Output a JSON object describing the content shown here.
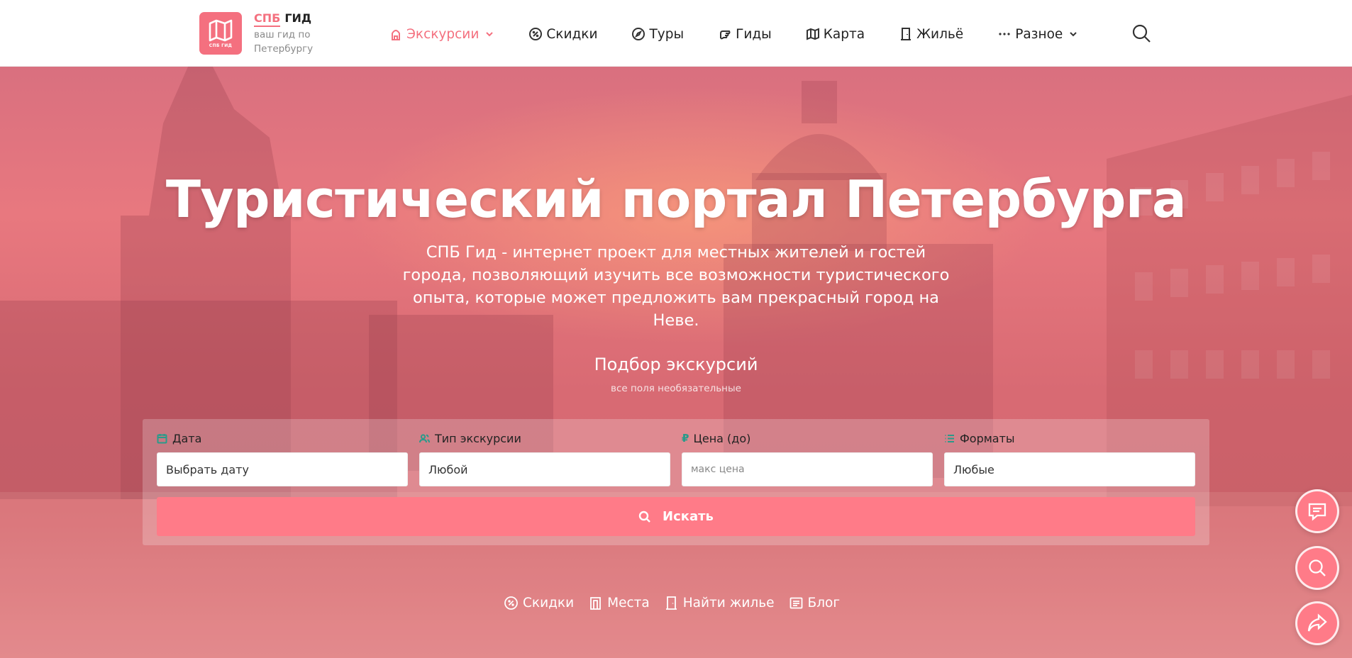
{
  "header": {
    "logo_text": "СПБ ГИД",
    "brand_spb": "СПБ",
    "brand_gid": "ГИД",
    "brand_sub": "ваш гид по Петербургу",
    "nav": [
      {
        "label": "Экскурсии",
        "icon": "excursion-icon",
        "active": true,
        "dropdown": true
      },
      {
        "label": "Скидки",
        "icon": "discount-icon"
      },
      {
        "label": "Туры",
        "icon": "compass-icon"
      },
      {
        "label": "Гиды",
        "icon": "hand-icon"
      },
      {
        "label": "Карта",
        "icon": "map-icon"
      },
      {
        "label": "Жильё",
        "icon": "door-icon"
      },
      {
        "label": "Разное",
        "icon": "dots-icon",
        "dropdown": true
      }
    ]
  },
  "hero": {
    "title": "Туристический портал Петербурга",
    "description": "СПБ Гид - интернет проект для местных жителей и гостей города, позволяющий изучить все возможности туристического опыта, которые может предложить вам прекрасный город на Неве.",
    "subtitle": "Подбор экскурсий",
    "note": "все поля необязательные"
  },
  "form": {
    "date": {
      "label": "Дата",
      "value": "Выбрать дату"
    },
    "type": {
      "label": "Тип экскурсии",
      "value": "Любой"
    },
    "price": {
      "label": "Цена (до)",
      "placeholder": "макс цена"
    },
    "formats": {
      "label": "Форматы",
      "value": "Любые"
    },
    "search_label": "Искать"
  },
  "quick_links": [
    {
      "label": "Скидки",
      "icon": "discount-icon"
    },
    {
      "label": "Места",
      "icon": "building-icon"
    },
    {
      "label": "Найти жилье",
      "icon": "door-icon"
    },
    {
      "label": "Блог",
      "icon": "blog-icon"
    }
  ],
  "colors": {
    "accent": "#f4707f",
    "button": "#ff7b88",
    "label_icon": "#2a9a8a"
  }
}
